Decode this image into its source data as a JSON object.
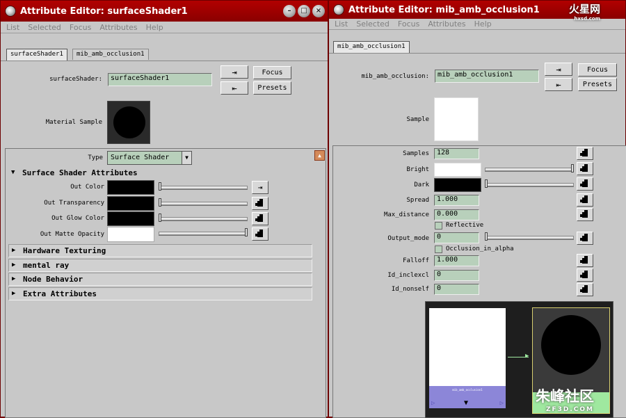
{
  "left": {
    "title": "Attribute Editor: surfaceShader1",
    "menu": [
      "List",
      "Selected",
      "Focus",
      "Attributes",
      "Help"
    ],
    "tabs": [
      "surfaceShader1",
      "mib_amb_occlusion1"
    ],
    "node_label": "surfaceShader:",
    "node_value": "surfaceShader1",
    "focus_label": "Focus",
    "presets_label": "Presets",
    "sample_label": "Material Sample",
    "type_label": "Type",
    "type_value": "Surface Shader",
    "section_main": "Surface Shader Attributes",
    "attrs": [
      "Out Color",
      "Out Transparency",
      "Out Glow Color",
      "Out Matte Opacity"
    ],
    "sections": [
      "Hardware Texturing",
      "mental ray",
      "Node Behavior",
      "Extra Attributes"
    ]
  },
  "right": {
    "title": "Attribute Editor: mib_amb_occlusion1",
    "menu": [
      "List",
      "Selected",
      "Focus",
      "Attributes",
      "Help"
    ],
    "tabs": [
      "mib_amb_occlusion1"
    ],
    "node_label": "mib_amb_occlusion:",
    "node_value": "mib_amb_occlusion1",
    "focus_label": "Focus",
    "presets_label": "Presets",
    "sample_label": "Sample",
    "attrs": {
      "samples": {
        "label": "Samples",
        "value": "128"
      },
      "bright": {
        "label": "Bright"
      },
      "dark": {
        "label": "Dark"
      },
      "spread": {
        "label": "Spread",
        "value": "1.000"
      },
      "max_distance": {
        "label": "Max_distance",
        "value": "0.000"
      },
      "reflective": {
        "label": "Reflective"
      },
      "output_mode": {
        "label": "Output_mode",
        "value": "0"
      },
      "occlusion_in_alpha": {
        "label": "Occlusion_in_alpha"
      },
      "falloff": {
        "label": "Falloff",
        "value": "1.000"
      },
      "id_inclexcl": {
        "label": "Id_inclexcl",
        "value": "0"
      },
      "id_nonself": {
        "label": "Id_nonself",
        "value": "0"
      }
    },
    "hypershade": {
      "node1": "mib_amb_occlusion1",
      "node2": "surfaceShader1"
    }
  },
  "watermarks": {
    "top": "火星网",
    "top_sub": "hxsd.com",
    "bottom": "朱峰社区",
    "bottom_sub": "ZF3D.COM"
  }
}
